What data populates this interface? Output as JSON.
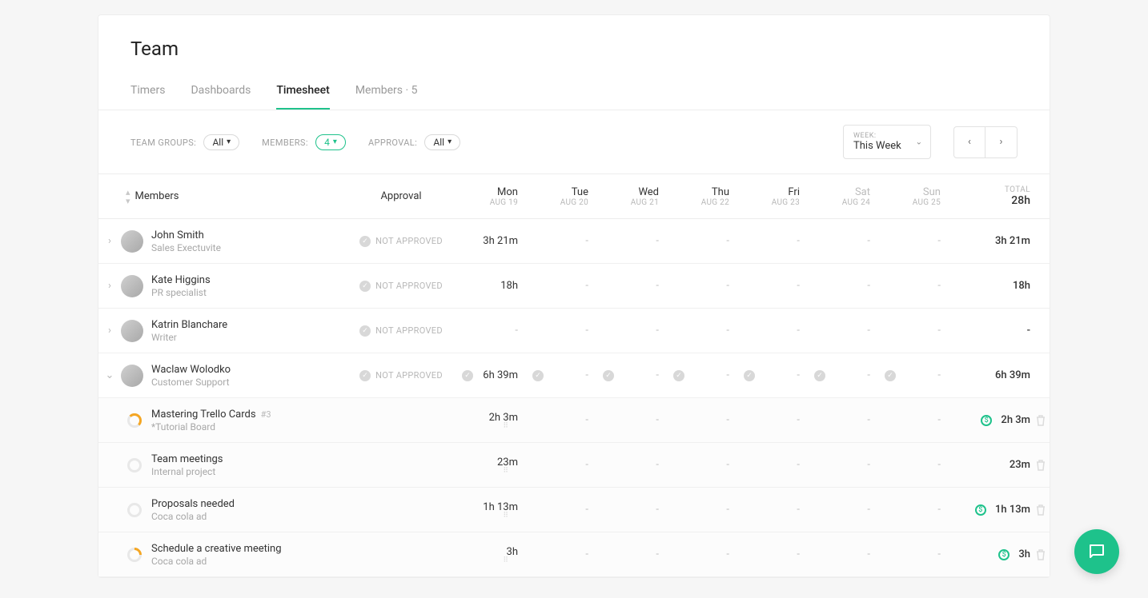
{
  "page": {
    "title": "Team"
  },
  "tabs": {
    "timers": "Timers",
    "dashboards": "Dashboards",
    "timesheet": "Timesheet",
    "members": "Members · 5",
    "active": "timesheet"
  },
  "filters": {
    "team_groups_label": "TEAM GROUPS:",
    "team_groups_value": "All",
    "members_label": "MEMBERS:",
    "members_value": "4",
    "approval_label": "APPROVAL:",
    "approval_value": "All",
    "week_label": "WEEK:",
    "week_value": "This Week"
  },
  "header": {
    "members": "Members",
    "approval": "Approval",
    "days": [
      {
        "name": "Mon",
        "date": "AUG 19",
        "weekend": false
      },
      {
        "name": "Tue",
        "date": "AUG 20",
        "weekend": false
      },
      {
        "name": "Wed",
        "date": "AUG 21",
        "weekend": false
      },
      {
        "name": "Thu",
        "date": "AUG 22",
        "weekend": false
      },
      {
        "name": "Fri",
        "date": "AUG 23",
        "weekend": false
      },
      {
        "name": "Sat",
        "date": "AUG 24",
        "weekend": true
      },
      {
        "name": "Sun",
        "date": "AUG 25",
        "weekend": true
      }
    ],
    "total_label": "TOTAL",
    "total_value": "28h"
  },
  "approval_status": {
    "not_approved": "NOT APPROVED"
  },
  "members": [
    {
      "name": "John Smith",
      "role": "Sales Exectuvite",
      "approval": "NOT APPROVED",
      "expanded": false,
      "days": [
        "3h 21m",
        "-",
        "-",
        "-",
        "-",
        "-",
        "-"
      ],
      "total": "3h 21m"
    },
    {
      "name": "Kate Higgins",
      "role": "PR specialist",
      "approval": "NOT APPROVED",
      "expanded": false,
      "days": [
        "18h",
        "-",
        "-",
        "-",
        "-",
        "-",
        "-"
      ],
      "total": "18h"
    },
    {
      "name": "Katrin Blanchare",
      "role": "Writer",
      "approval": "NOT APPROVED",
      "expanded": false,
      "days": [
        "-",
        "-",
        "-",
        "-",
        "-",
        "-",
        "-"
      ],
      "total": "-"
    },
    {
      "name": "Waclaw Wolodko",
      "role": "Customer Support",
      "approval": "NOT APPROVED",
      "expanded": true,
      "days": [
        "6h 39m",
        "-",
        "-",
        "-",
        "-",
        "-",
        "-"
      ],
      "day_checks": [
        true,
        true,
        true,
        true,
        true,
        true,
        true
      ],
      "total": "6h 39m"
    }
  ],
  "tasks": [
    {
      "name": "Mastering Trello Cards",
      "tag": "#3",
      "project": "*Tutorial Board",
      "progress": "p50",
      "days": [
        "2h 3m",
        "-",
        "-",
        "-",
        "-",
        "-",
        "-"
      ],
      "billable": true,
      "total": "2h 3m"
    },
    {
      "name": "Team meetings",
      "tag": "",
      "project": "Internal project",
      "progress": "",
      "days": [
        "23m",
        "-",
        "-",
        "-",
        "-",
        "-",
        "-"
      ],
      "billable": false,
      "total": "23m"
    },
    {
      "name": "Proposals needed",
      "tag": "",
      "project": "Coca cola ad",
      "progress": "",
      "days": [
        "1h 13m",
        "-",
        "-",
        "-",
        "-",
        "-",
        "-"
      ],
      "billable": true,
      "total": "1h 13m"
    },
    {
      "name": "Schedule a creative meeting",
      "tag": "",
      "project": "Coca cola ad",
      "progress": "p25",
      "days": [
        "3h",
        "-",
        "-",
        "-",
        "-",
        "-",
        "-"
      ],
      "billable": true,
      "total": "3h"
    }
  ]
}
